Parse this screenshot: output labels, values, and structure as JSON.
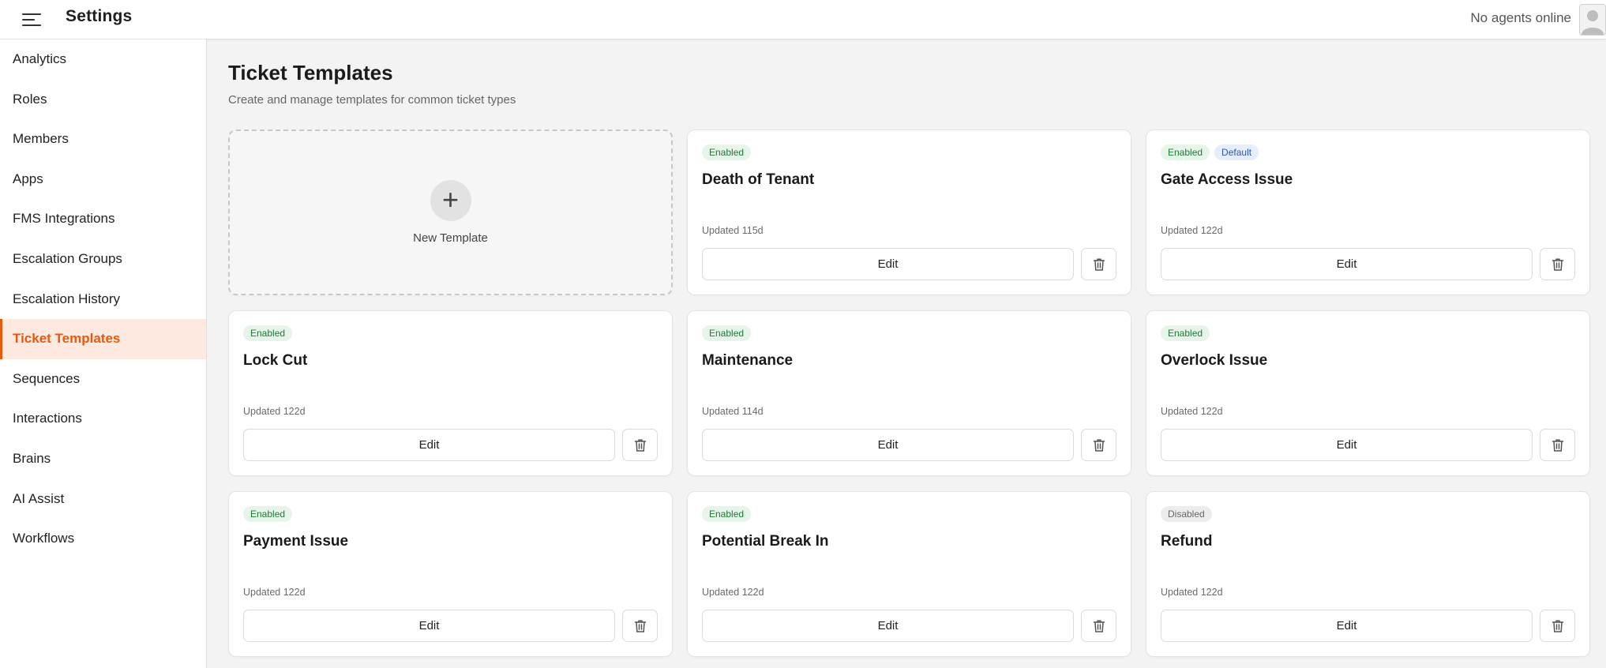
{
  "header": {
    "title": "Settings",
    "agents_status": "No agents online"
  },
  "sidebar": {
    "items": [
      {
        "label": "Analytics",
        "active": false
      },
      {
        "label": "Roles",
        "active": false
      },
      {
        "label": "Members",
        "active": false
      },
      {
        "label": "Apps",
        "active": false
      },
      {
        "label": "FMS Integrations",
        "active": false
      },
      {
        "label": "Escalation Groups",
        "active": false
      },
      {
        "label": "Escalation History",
        "active": false
      },
      {
        "label": "Ticket Templates",
        "active": true
      },
      {
        "label": "Sequences",
        "active": false
      },
      {
        "label": "Interactions",
        "active": false
      },
      {
        "label": "Brains",
        "active": false
      },
      {
        "label": "AI Assist",
        "active": false
      },
      {
        "label": "Workflows",
        "active": false
      }
    ]
  },
  "main": {
    "title": "Ticket Templates",
    "subtitle": "Create and manage templates for common ticket types",
    "new_template_label": "New Template",
    "new_template_icon": "+",
    "edit_label": "Edit",
    "templates": [
      {
        "name": "Death of Tenant",
        "status": "Enabled",
        "default_badge": "",
        "updated": "Updated 115d"
      },
      {
        "name": "Gate Access Issue",
        "status": "Enabled",
        "default_badge": "Default",
        "updated": "Updated 122d"
      },
      {
        "name": "Lock Cut",
        "status": "Enabled",
        "default_badge": "",
        "updated": "Updated 122d"
      },
      {
        "name": "Maintenance",
        "status": "Enabled",
        "default_badge": "",
        "updated": "Updated 114d"
      },
      {
        "name": "Overlock Issue",
        "status": "Enabled",
        "default_badge": "",
        "updated": "Updated 122d"
      },
      {
        "name": "Payment Issue",
        "status": "Enabled",
        "default_badge": "",
        "updated": "Updated 122d"
      },
      {
        "name": "Potential Break In",
        "status": "Enabled",
        "default_badge": "",
        "updated": "Updated 122d"
      },
      {
        "name": "Refund",
        "status": "Disabled",
        "default_badge": "",
        "updated": "Updated 122d"
      }
    ]
  },
  "colors": {
    "accent": "#e8590c",
    "active_bg": "#fde9df",
    "enabled_badge": "#1e7b34",
    "default_badge": "#2a55c0",
    "disabled_badge": "#666666"
  }
}
